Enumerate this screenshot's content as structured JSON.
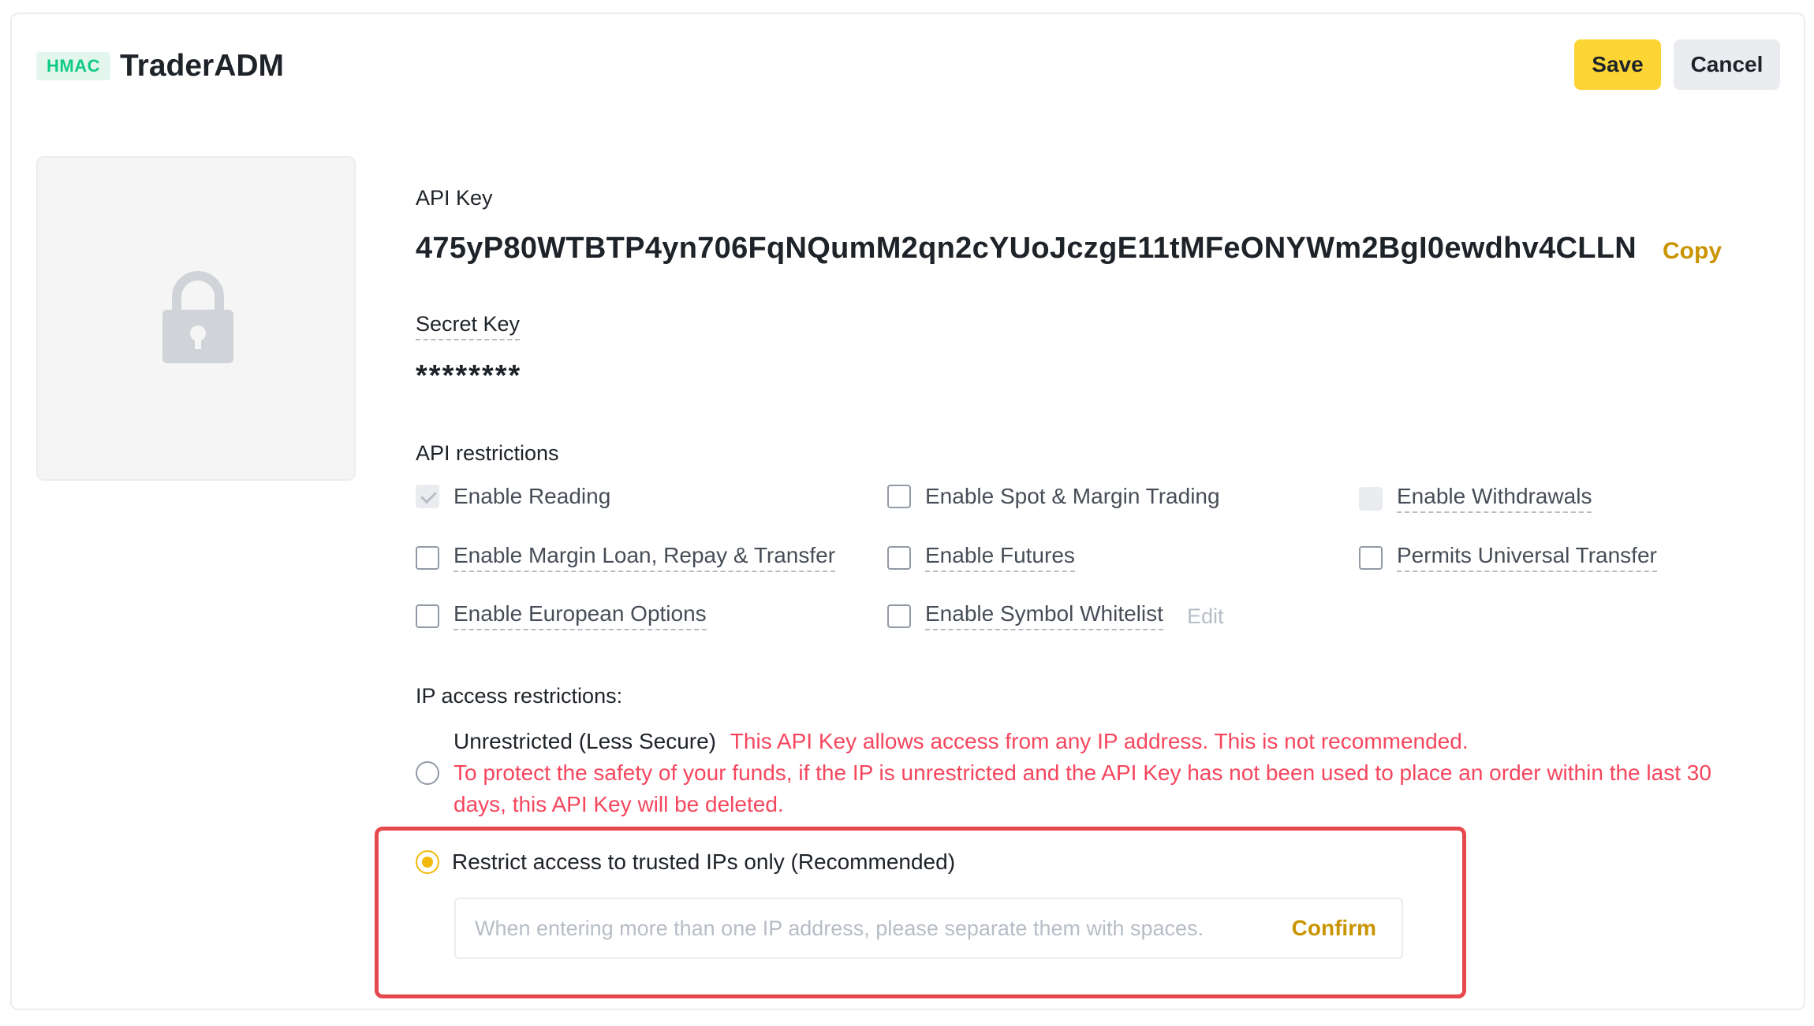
{
  "header": {
    "badge": "HMAC",
    "title": "TraderADM",
    "save_label": "Save",
    "cancel_label": "Cancel"
  },
  "api_key": {
    "label": "API Key",
    "value": "475yP80WTBTP4yn706FqNQumM2qn2cYUoJczgE11tMFeONYWm2BgI0ewdhv4CLLN",
    "copy_label": "Copy"
  },
  "secret_key": {
    "label": "Secret Key",
    "value": "********"
  },
  "restrictions": {
    "label": "API restrictions",
    "items": [
      {
        "label": "Enable Reading",
        "state": "checked-disabled"
      },
      {
        "label": "Enable Spot & Margin Trading",
        "state": "unchecked"
      },
      {
        "label": "Enable Withdrawals",
        "state": "disabled"
      },
      {
        "label": "Enable Margin Loan, Repay & Transfer",
        "state": "unchecked"
      },
      {
        "label": "Enable Futures",
        "state": "unchecked"
      },
      {
        "label": "Permits Universal Transfer",
        "state": "unchecked"
      },
      {
        "label": "Enable European Options",
        "state": "unchecked"
      },
      {
        "label": "Enable Symbol Whitelist",
        "state": "unchecked"
      }
    ],
    "edit_label": "Edit"
  },
  "ip": {
    "label": "IP access restrictions:",
    "unrestricted_label": "Unrestricted (Less Secure)",
    "unrestricted_warning": "This API Key allows access from any IP address. This is not recommended.",
    "unrestricted_notice_line1": "To protect the safety of your funds, if the IP is unrestricted and the API Key has not been used to place an order within the last 30",
    "unrestricted_notice_line2": "days, this API Key will be deleted.",
    "restrict_label": "Restrict access to trusted IPs only (Recommended)",
    "input_placeholder": "When entering more than one IP address, please separate them with spaces.",
    "input_value": "",
    "confirm_label": "Confirm",
    "selected": "restrict"
  },
  "colors": {
    "accent": "#fcd535",
    "accent_text": "#c99400",
    "warning": "#f6465d",
    "badge_green": "#0ecb81",
    "highlight_border": "#e5484d"
  },
  "icons": {
    "qr_placeholder": "lock-icon"
  }
}
